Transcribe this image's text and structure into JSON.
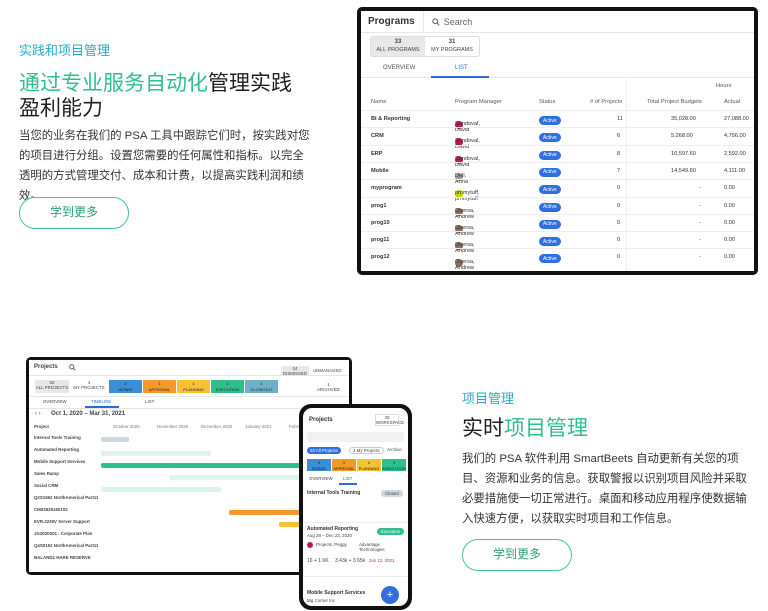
{
  "section1": {
    "eyebrow": "实践和项目管理",
    "title_highlight": "通过专业服务自动化",
    "title_rest": "管理实践",
    "title_line2": "盈利能力",
    "paragraph": "当您的业务在我们的 PSA 工具中跟踪它们时，按实践对您的项目进行分组。设置您需要的任何属性和指标。以完全透明的方式管理交付、成本和计费，以提高实践利润和绩效。",
    "button": "学到更多"
  },
  "section2": {
    "eyebrow": "项目管理",
    "title_plain": "实时",
    "title_highlight": "项目管理",
    "paragraph": "我们的 PSA 软件利用 SmartBeets 自动更新有关您的项目、资源和业务的信息。获取警报以识别项目风险并采取必要措施使一切正常进行。桌面和移动应用程序使数据输入快速方便，以获取实时项目和工作信息。",
    "button": "学到更多"
  },
  "programs_app": {
    "title": "Programs",
    "search": "Search",
    "seg_all_count": "33",
    "seg_all_label": "ALL PROGRAMS",
    "seg_my_count": "31",
    "seg_my_label": "MY PROGRAMS",
    "tab_overview": "OVERVIEW",
    "tab_list": "LIST",
    "hours_group": "Hours",
    "columns": [
      "Name",
      "Program Manager",
      "Status",
      "# of Projects",
      "Total Project Budgets",
      "Actual"
    ],
    "rows": [
      {
        "name": "BI & Reporting",
        "manager": "Sandoval, David",
        "status": "Active",
        "projects": "11",
        "budget": "35,028.00",
        "actual": "27,088.00",
        "color": "#c2185b"
      },
      {
        "name": "CRM",
        "manager": "Sandoval, David",
        "status": "Active",
        "projects": "6",
        "budget": "5,268.00",
        "actual": "4,756.00",
        "color": "#c2185b"
      },
      {
        "name": "ERP",
        "manager": "Sandoval, David",
        "status": "Active",
        "projects": "8",
        "budget": "10,597.60",
        "actual": "2,592.00",
        "color": "#c2185b"
      },
      {
        "name": "Mobile",
        "manager": "Dell, Anna",
        "status": "Active",
        "projects": "7",
        "budget": "14,549.60",
        "actual": "4,111.00",
        "color": "#9e9e9e"
      },
      {
        "name": "myprogram",
        "manager": "pmmytuff, pmmytuff",
        "status": "Active",
        "projects": "0",
        "budget": "-",
        "actual": "0.00",
        "color": "#c6d600"
      },
      {
        "name": "prog1",
        "manager": "Oversa, Andrew",
        "status": "Active",
        "projects": "0",
        "budget": "-",
        "actual": "0.00",
        "color": "#8d6e63"
      },
      {
        "name": "prog10",
        "manager": "Oversa, Andrew",
        "status": "Active",
        "projects": "0",
        "budget": "-",
        "actual": "0.00",
        "color": "#8d6e63"
      },
      {
        "name": "prog11",
        "manager": "Oversa, Andrew",
        "status": "Active",
        "projects": "0",
        "budget": "-",
        "actual": "0.00",
        "color": "#8d6e63"
      },
      {
        "name": "prog12",
        "manager": "Oversa, Andrew",
        "status": "Active",
        "projects": "0",
        "budget": "-",
        "actual": "0.00",
        "color": "#8d6e63"
      }
    ]
  },
  "projects_app": {
    "title": "Projects",
    "all_count": "50",
    "all_label": "ALL PROJECTS",
    "my_count": "4",
    "my_label": "MY PROJECTS",
    "stages": [
      {
        "count": "4",
        "label": "INTAKE",
        "color": "#3a8fd6"
      },
      {
        "count": "1",
        "label": "APPROVAL",
        "color": "#f39a2b"
      },
      {
        "count": "4",
        "label": "PLANNING",
        "color": "#f6c233"
      },
      {
        "count": "4",
        "label": "EXECUTION",
        "color": "#2fbf8a"
      },
      {
        "count": "4",
        "label": "CLOSEOUT",
        "color": "#6fb0c7"
      }
    ],
    "tab_overview": "OVERVIEW",
    "tab_timeline": "TIMELINE",
    "tab_list": "LIST",
    "date_range": "Oct 1, 2020 – Mar 31, 2021",
    "task_header": "Project",
    "months": [
      "October 2020",
      "November 2020",
      "December 2020",
      "January 2021",
      "February 2021"
    ],
    "tasks": [
      "Internal Tools Training",
      "Automated Reporting",
      "Mobile Support Services",
      "Sales Ramp",
      "Social CRM",
      "Q2S1562 NorthAmerical Part11 F...",
      "CM03535160102",
      "EVR.3230V Server Support",
      "JG2020001 : Corporate Plan",
      "Q4S0152 NorthAmerical Part11 P...",
      "BALAND1 HARE RESERVE"
    ],
    "dismissed_count": "24",
    "dismissed_label": "DISMISSED",
    "unmanaged_label": "UNMANAGED",
    "archived_count": "1",
    "archived_label": "ARCHIVED"
  },
  "phone_app": {
    "title": "Projects",
    "count": "30",
    "count_label": "WORKSPACE",
    "chip_all": "20 All Projects",
    "chip_my": "4 My Projects",
    "chip_arch": "Archive",
    "tab_overview": "OVERVIEW",
    "tab_list": "LIST",
    "card1_title": "Internal Tools Training",
    "card1_badge": "Closed",
    "card2_title": "Automated Reporting",
    "card2_dates": "Aug 28 – Dec 23, 2020",
    "card2_badge": "Execution",
    "card2_owner": "Projects, Peggy",
    "card2_company": "Advantage Technologies",
    "card2_hours": "16 + 1.6K",
    "card2_cost": "3.43k + 3 65k",
    "card2_date": "Jun 12, 2021",
    "card3_title": "Mobile Support Services",
    "card3_sub": "Big Corner Inc"
  }
}
